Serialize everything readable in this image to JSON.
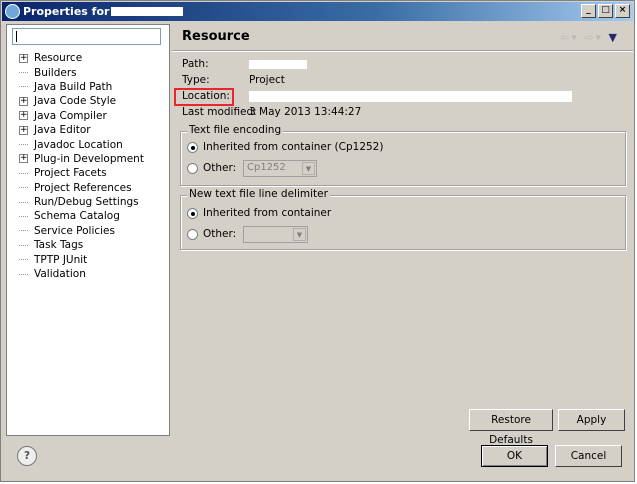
{
  "window": {
    "title": "Properties for"
  },
  "filter": {
    "placeholder": ""
  },
  "tree": [
    {
      "label": "Resource",
      "expandable": true
    },
    {
      "label": "Builders",
      "expandable": false
    },
    {
      "label": "Java Build Path",
      "expandable": false
    },
    {
      "label": "Java Code Style",
      "expandable": true
    },
    {
      "label": "Java Compiler",
      "expandable": true
    },
    {
      "label": "Java Editor",
      "expandable": true
    },
    {
      "label": "Javadoc Location",
      "expandable": false
    },
    {
      "label": "Plug-in Development",
      "expandable": true
    },
    {
      "label": "Project Facets",
      "expandable": false
    },
    {
      "label": "Project References",
      "expandable": false
    },
    {
      "label": "Run/Debug Settings",
      "expandable": false
    },
    {
      "label": "Schema Catalog",
      "expandable": false
    },
    {
      "label": "Service Policies",
      "expandable": false
    },
    {
      "label": "Task Tags",
      "expandable": false
    },
    {
      "label": "TPTP JUnit",
      "expandable": false
    },
    {
      "label": "Validation",
      "expandable": false
    }
  ],
  "page": {
    "title": "Resource",
    "path_label": "Path:",
    "type_label": "Type:",
    "type_value": "Project",
    "location_label": "Location:",
    "modified_label": "Last modified:",
    "modified_value": "3 May 2013 13:44:27",
    "encoding": {
      "legend": "Text file encoding",
      "inherited": "Inherited from container (Cp1252)",
      "other": "Other:",
      "other_value": "Cp1252"
    },
    "delimiter": {
      "legend": "New text file line delimiter",
      "inherited": "Inherited from container",
      "other": "Other:"
    },
    "restore_defaults": "Restore Defaults",
    "apply": "Apply"
  },
  "footer": {
    "ok": "OK",
    "cancel": "Cancel",
    "help": "?"
  },
  "colors": {
    "highlight": "#e8262b",
    "titlebar": "#0a246a"
  }
}
